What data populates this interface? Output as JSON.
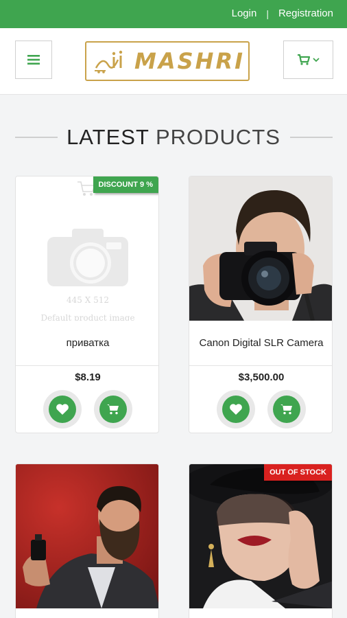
{
  "topbar": {
    "login": "Login",
    "separator": "|",
    "registration": "Registration"
  },
  "header": {
    "logo_text": "MASHRI",
    "menu_icon": "hamburger-icon",
    "cart_icon": "cart-icon"
  },
  "section": {
    "title_first": "LATEST",
    "title_second": "PRODUCTS"
  },
  "products": [
    {
      "name": "приватка",
      "price": "$8.19",
      "badge": "DISCOUNT 9 %",
      "image": "default-product-placeholder",
      "placeholder_size": "445 X 512",
      "placeholder_caption": "Default product image"
    },
    {
      "name": "Canon Digital SLR Camera",
      "price": "$3,500.00",
      "badge": "",
      "image": "man-with-camera-photo"
    },
    {
      "name": "",
      "price": "",
      "badge": "",
      "image": "bearded-man-with-perfume-photo"
    },
    {
      "name": "",
      "price": "",
      "badge": "OUT OF STOCK",
      "image": "woman-with-hat-photo"
    }
  ],
  "colors": {
    "brand_green": "#3fa54f",
    "logo_gold": "#c9a24a",
    "badge_red": "#d9211f"
  }
}
